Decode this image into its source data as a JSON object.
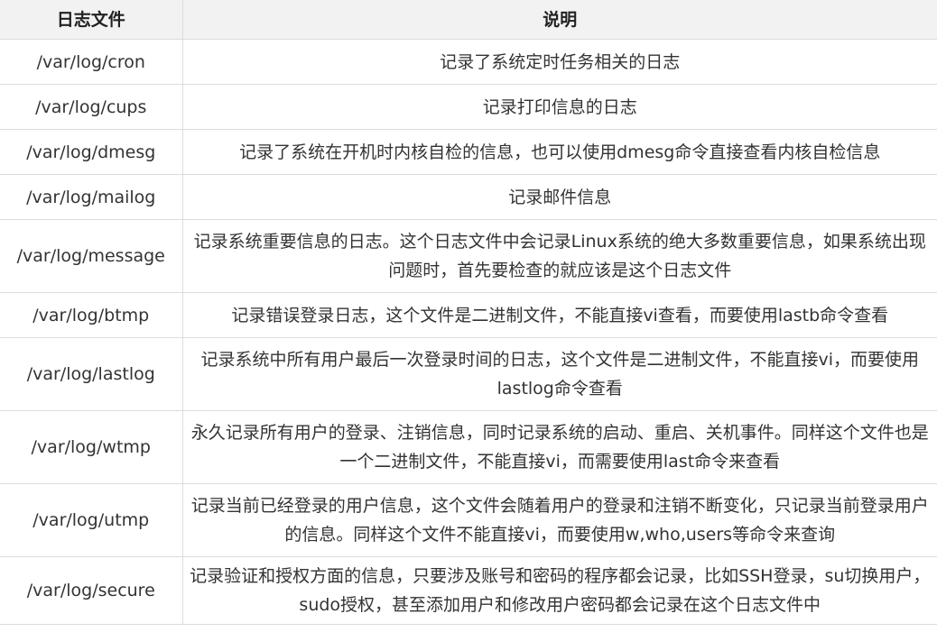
{
  "table": {
    "headers": [
      "日志文件",
      "说明"
    ],
    "rows": [
      {
        "file": "/var/log/cron",
        "desc": "记录了系统定时任务相关的日志"
      },
      {
        "file": "/var/log/cups",
        "desc": "记录打印信息的日志"
      },
      {
        "file": "/var/log/dmesg",
        "desc": "记录了系统在开机时内核自检的信息，也可以使用dmesg命令直接查看内核自检信息"
      },
      {
        "file": "/var/log/mailog",
        "desc": "记录邮件信息"
      },
      {
        "file": "/var/log/message",
        "desc": "记录系统重要信息的日志。这个日志文件中会记录Linux系统的绝大多数重要信息，如果系统出现问题时，首先要检查的就应该是这个日志文件"
      },
      {
        "file": "/var/log/btmp",
        "desc": "记录错误登录日志，这个文件是二进制文件，不能直接vi查看，而要使用lastb命令查看"
      },
      {
        "file": "/var/log/lastlog",
        "desc": "记录系统中所有用户最后一次登录时间的日志，这个文件是二进制文件，不能直接vi，而要使用lastlog命令查看"
      },
      {
        "file": "/var/log/wtmp",
        "desc": "永久记录所有用户的登录、注销信息，同时记录系统的启动、重启、关机事件。同样这个文件也是一个二进制文件，不能直接vi，而需要使用last命令来查看"
      },
      {
        "file": "/var/log/utmp",
        "desc": "记录当前已经登录的用户信息，这个文件会随着用户的登录和注销不断变化，只记录当前登录用户的信息。同样这个文件不能直接vi，而要使用w,who,users等命令来查询"
      },
      {
        "file": "/var/log/secure",
        "desc": "记录验证和授权方面的信息，只要涉及账号和密码的程序都会记录，比如SSH登录，su切换用户，sudo授权，甚至添加用户和修改用户密码都会记录在这个日志文件中"
      }
    ]
  }
}
